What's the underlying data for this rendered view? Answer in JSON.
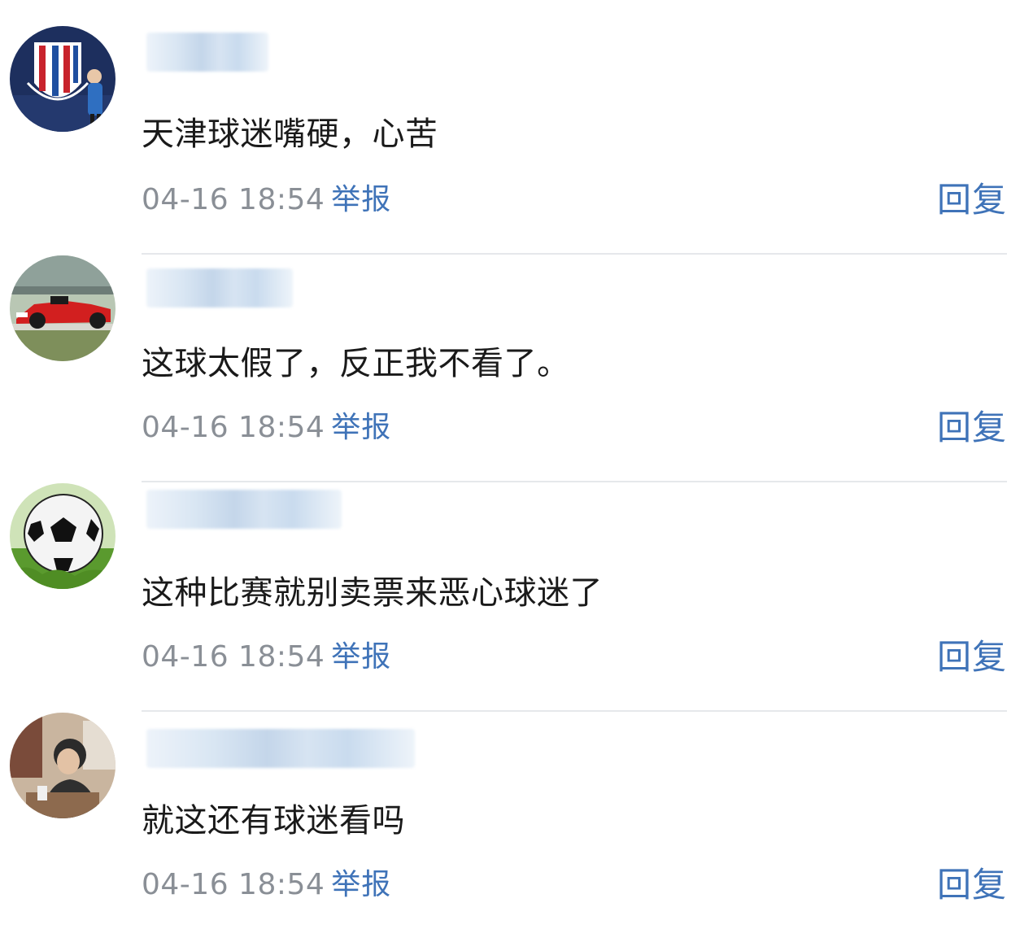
{
  "comments": [
    {
      "avatar_icon": "club-crest-avatar-icon",
      "username": "",
      "text": "天津球迷嘴硬，心苦",
      "timestamp": "04-16 18:54",
      "report_label": "举报",
      "reply_label": "回复"
    },
    {
      "avatar_icon": "race-car-avatar-icon",
      "username": "",
      "text": "这球太假了，反正我不看了。",
      "timestamp": "04-16 18:54",
      "report_label": "举报",
      "reply_label": "回复"
    },
    {
      "avatar_icon": "soccer-ball-avatar-icon",
      "username": "",
      "text": "这种比赛就别卖票来恶心球迷了",
      "timestamp": "04-16 18:54",
      "report_label": "举报",
      "reply_label": "回复"
    },
    {
      "avatar_icon": "person-photo-avatar-icon",
      "username": "",
      "text": "就这还有球迷看吗",
      "timestamp": "04-16 18:54",
      "report_label": "举报",
      "reply_label": "回复"
    }
  ],
  "colors": {
    "link": "#3f73b8",
    "timestamp": "#8a8f96",
    "text": "#1a1a1a",
    "divider": "#e6e8eb"
  }
}
